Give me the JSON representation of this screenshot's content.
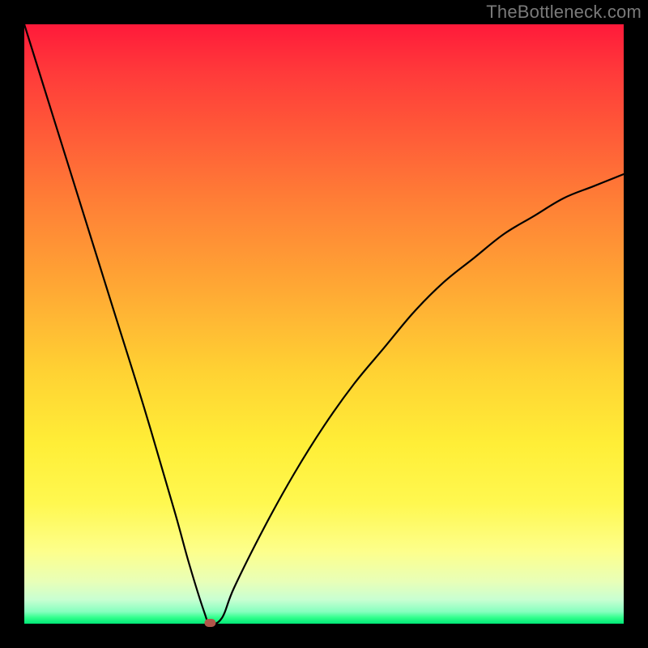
{
  "watermark": "TheBottleneck.com",
  "chart_data": {
    "type": "line",
    "title": "",
    "xlabel": "",
    "ylabel": "",
    "xlim": [
      0,
      100
    ],
    "ylim": [
      0,
      100
    ],
    "grid": false,
    "legend": false,
    "series": [
      {
        "name": "bottleneck-curve",
        "x": [
          0,
          5,
          10,
          15,
          20,
          25,
          27.5,
          30,
          31,
          33,
          35,
          40,
          45,
          50,
          55,
          60,
          65,
          70,
          75,
          80,
          85,
          90,
          95,
          100
        ],
        "values": [
          100,
          84,
          68,
          52,
          36,
          19,
          10,
          2,
          0,
          1,
          6,
          16,
          25,
          33,
          40,
          46,
          52,
          57,
          61,
          65,
          68,
          71,
          73,
          75
        ]
      }
    ],
    "marker": {
      "x": 31,
      "y": 0,
      "color": "#b0564a"
    },
    "background_gradient": {
      "top": "#ff1a3a",
      "mid": "#ffd233",
      "bottom": "#00e676"
    }
  }
}
